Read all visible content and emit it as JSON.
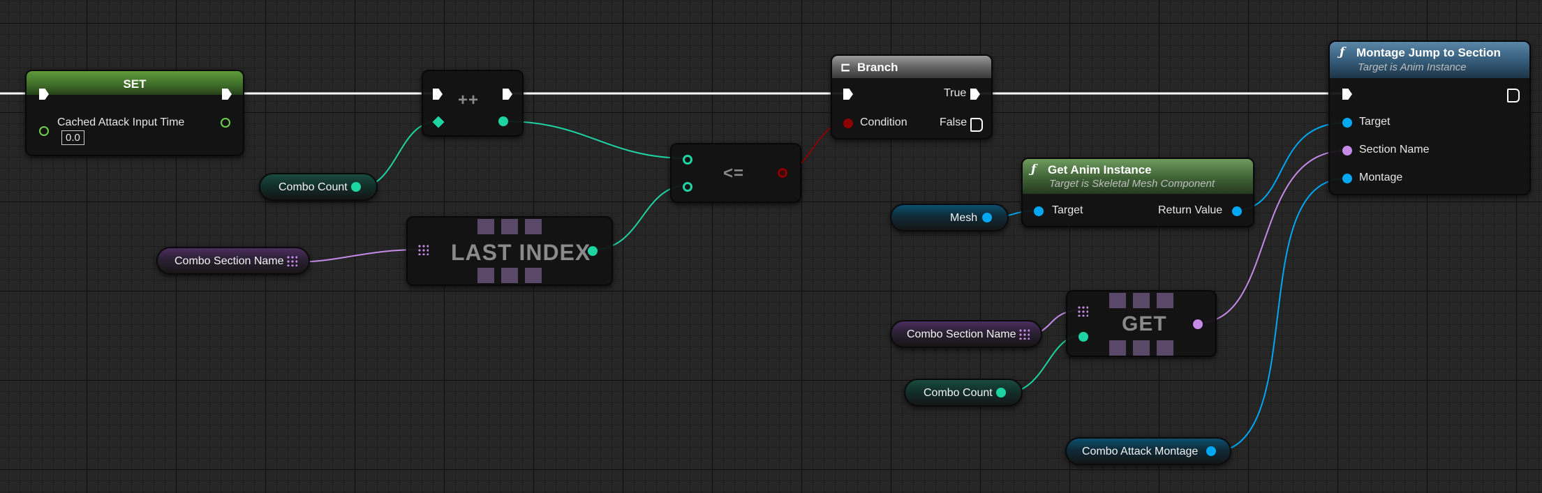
{
  "colors": {
    "exec": "#ffffff",
    "int": "#1fd4a3",
    "bool": "#8c0000",
    "object": "#00a8f4",
    "name": "#c58be8",
    "array_name": "#c58be8"
  },
  "nodes": {
    "set": {
      "title": "SET",
      "var_label": "Cached Attack Input Time",
      "value": "0.0"
    },
    "increment": {
      "op": "++"
    },
    "less_equal": {
      "op": "<="
    },
    "last_index": {
      "op": "LAST INDEX"
    },
    "branch": {
      "title": "Branch",
      "condition": "Condition",
      "true_label": "True",
      "false_label": "False"
    },
    "get_anim_instance": {
      "title": "Get Anim Instance",
      "subtitle": "Target is Skeletal Mesh Component",
      "target": "Target",
      "return_value": "Return Value"
    },
    "get": {
      "op": "GET"
    },
    "montage_jump": {
      "title": "Montage Jump to Section",
      "subtitle": "Target is Anim Instance",
      "target": "Target",
      "section_name": "Section Name",
      "montage": "Montage"
    }
  },
  "variables": {
    "combo_count_1": "Combo Count",
    "combo_section_name_1": "Combo Section Name",
    "mesh": "Mesh",
    "combo_section_name_2": "Combo Section Name",
    "combo_count_2": "Combo Count",
    "combo_attack_montage": "Combo Attack Montage"
  },
  "icons": {
    "function": "function-icon",
    "branch": "branch-icon",
    "array": "array-grid-icon"
  }
}
